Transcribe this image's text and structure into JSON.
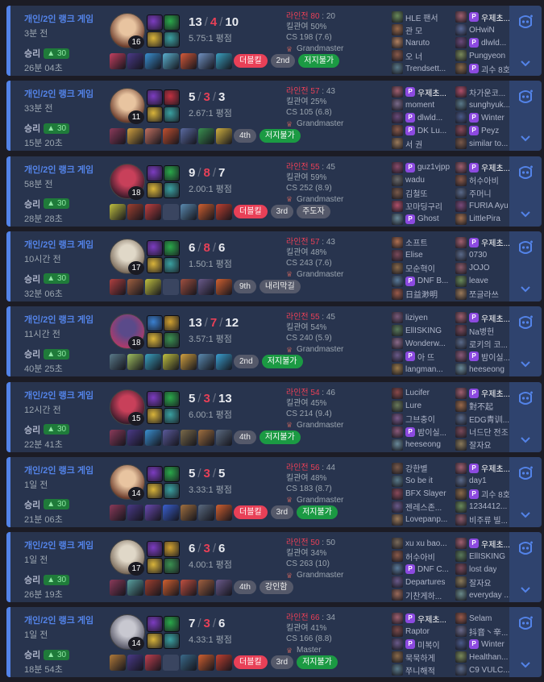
{
  "labels": {
    "kill_participation": "킬관여",
    "avg": "평점",
    "cs": "CS"
  },
  "colors": {
    "win_accent": "#5383e8",
    "lose_text": "#e84057",
    "tag_green": "#1b9a43",
    "tag_red": "#e84057"
  },
  "matches": [
    {
      "queue": "개인/2인 랭크 게임",
      "ago": "3분 전",
      "result": "승리",
      "lp": "30",
      "duration": "26분 04초",
      "champion": "Ahri",
      "level": "16",
      "spells": [
        "#7c3cc0",
        "#2aa84a"
      ],
      "runes": [
        "#d9b43a",
        "#3aa0a0"
      ],
      "kills": "13",
      "deaths": "4",
      "assists": "10",
      "kda_ratio": "5.75:1 평점",
      "items": [
        "#c24060",
        "#4a3a88",
        "#3a8fd0",
        "#5bb0d0",
        "#d45a3a",
        "#7090c0",
        "#3aa0c0"
      ],
      "tags": [
        {
          "text": "더블킬",
          "style": "red"
        },
        {
          "text": "2nd",
          "style": "gray"
        },
        {
          "text": "저지불가",
          "style": "green"
        }
      ],
      "laner": "라인전",
      "laner_score": "80",
      "laner_opp": "20",
      "kp": "킬관여 50%",
      "cs": "CS 198 (7.6)",
      "rank": "Grandmaster",
      "team1": [
        {
          "name": "HLE 팬서",
          "c": "#6a8a5a"
        },
        {
          "name": "관 모",
          "c": "#9a6a4a"
        },
        {
          "name": "Naruto",
          "c": "#b08060"
        },
        {
          "name": "오 너",
          "c": "#8a5a4a"
        },
        {
          "name": "Trendsett...",
          "c": "#5a7a8a"
        }
      ],
      "team2": [
        {
          "name": "우제초...",
          "c": "#a06070",
          "me": true,
          "badge": true
        },
        {
          "name": "OHwiN",
          "c": "#5a6a9a"
        },
        {
          "name": "dlwld...",
          "c": "#6a4a7a",
          "badge": true
        },
        {
          "name": "Pungyeon",
          "c": "#7a8a5a"
        },
        {
          "name": "괴수 8호",
          "c": "#8a6a4a",
          "badge": true
        }
      ]
    },
    {
      "queue": "개인/2인 랭크 게임",
      "ago": "33분 전",
      "result": "승리",
      "lp": "30",
      "duration": "15분 20초",
      "champion": "Ahri",
      "level": "11",
      "spells": [
        "#7c3cc0",
        "#c03040"
      ],
      "runes": [
        "#d9b43a",
        "#3aa0a0"
      ],
      "kills": "5",
      "deaths": "3",
      "assists": "3",
      "kda_ratio": "2.67:1 평점",
      "items": [
        "#8a3a5a",
        "#d0a040",
        "#c07060",
        "#c05030",
        "#5a6aa0",
        "#3a9050",
        "#d0b040"
      ],
      "tags": [
        {
          "text": "4th",
          "style": "gray"
        },
        {
          "text": "저지불가",
          "style": "green"
        }
      ],
      "laner": "라인전",
      "laner_score": "57",
      "laner_opp": "43",
      "kp": "킬관여 25%",
      "cs": "CS 105 (6.8)",
      "rank": "Grandmaster",
      "team1": [
        {
          "name": "우제초...",
          "c": "#a06070",
          "me": true,
          "badge": true
        },
        {
          "name": "moment",
          "c": "#7a6a8a"
        },
        {
          "name": "dlwld...",
          "c": "#6a4a7a",
          "badge": true
        },
        {
          "name": "DK Lu...",
          "c": "#8a5a4a",
          "badge": true
        },
        {
          "name": "서 권",
          "c": "#9a7a5a"
        }
      ],
      "team2": [
        {
          "name": "차가운코...",
          "c": "#b0506a"
        },
        {
          "name": "sunghyuk...",
          "c": "#5a7a8a"
        },
        {
          "name": "Winter",
          "c": "#4a5a8a",
          "badge": true
        },
        {
          "name": "Peyz",
          "c": "#8a4a5a",
          "badge": true
        },
        {
          "name": "similar to...",
          "c": "#7a5a4a"
        }
      ]
    },
    {
      "queue": "개인/2인 랭크 게임",
      "ago": "58분 전",
      "result": "승리",
      "lp": "30",
      "duration": "28분 28초",
      "champion": "Fiora",
      "level": "18",
      "spells": [
        "#7c3cc0",
        "#2aa84a"
      ],
      "runes": [
        "#d9b43a",
        "#3aa0a0"
      ],
      "kills": "9",
      "deaths": "8",
      "assists": "7",
      "kda_ratio": "2.00:1 평점",
      "items": [
        "#c0c040",
        "#a04030",
        "#c04040",
        "empty",
        "#5a8ab0",
        "#d06030",
        "#c04030"
      ],
      "tags": [
        {
          "text": "더블킬",
          "style": "red"
        },
        {
          "text": "3rd",
          "style": "gray"
        },
        {
          "text": "주도자",
          "style": "gray"
        }
      ],
      "laner": "라인전",
      "laner_score": "55",
      "laner_opp": "45",
      "kp": "킬관여 59%",
      "cs": "CS 252 (8.9)",
      "rank": "Grandmaster",
      "team1": [
        {
          "name": "guz1vjpp...",
          "c": "#8a4a6a",
          "badge": true
        },
        {
          "name": "wadu",
          "c": "#6a6a6a"
        },
        {
          "name": "김철또",
          "c": "#7a5a4a"
        },
        {
          "name": "꼬마딩구리",
          "c": "#b0506a"
        },
        {
          "name": "Ghost",
          "c": "#6a8a9a",
          "badge": true
        }
      ],
      "team2": [
        {
          "name": "우제초...",
          "c": "#a06070",
          "me": true,
          "badge": true
        },
        {
          "name": "허수아비",
          "c": "#8a5a4a"
        },
        {
          "name": "주머니",
          "c": "#5a6a8a"
        },
        {
          "name": "FURIA Ayu",
          "c": "#7a4a7a"
        },
        {
          "name": "LittlePira",
          "c": "#a07050"
        }
      ]
    },
    {
      "queue": "개인/2인 랭크 게임",
      "ago": "10시간 전",
      "result": "승리",
      "lp": "30",
      "duration": "32분 06초",
      "champion": "Camille",
      "level": "17",
      "spells": [
        "#7c3cc0",
        "#2aa84a"
      ],
      "runes": [
        "#d9b43a",
        "#3aa0a0"
      ],
      "kills": "6",
      "deaths": "8",
      "assists": "6",
      "kda_ratio": "1.50:1 평점",
      "items": [
        "#b04040",
        "#a06040",
        "#c0c040",
        "empty",
        "#a05040",
        "#6a5a8a",
        "#d06030"
      ],
      "tags": [
        {
          "text": "9th",
          "style": "gray"
        },
        {
          "text": "내리막길",
          "style": "gray"
        }
      ],
      "laner": "라인전",
      "laner_score": "57",
      "laner_opp": "43",
      "kp": "킬관여 48%",
      "cs": "CS 243 (7.6)",
      "rank": "Grandmaster",
      "team1": [
        {
          "name": "소프트",
          "c": "#b07050"
        },
        {
          "name": "Elise",
          "c": "#7a4a5a"
        },
        {
          "name": "모순혁이",
          "c": "#8a6a4a"
        },
        {
          "name": "DNF B...",
          "c": "#5a7a9a",
          "badge": true
        },
        {
          "name": "日益渺明",
          "c": "#9a5a4a"
        }
      ],
      "team2": [
        {
          "name": "우제초...",
          "c": "#a06070",
          "me": true,
          "badge": true
        },
        {
          "name": "0730",
          "c": "#5a6a8a"
        },
        {
          "name": "JOJO",
          "c": "#8a5a6a"
        },
        {
          "name": "leave",
          "c": "#6a8a5a"
        },
        {
          "name": "쪼글라쓰",
          "c": "#9a7a5a"
        }
      ]
    },
    {
      "queue": "개인/2인 랭크 게임",
      "ago": "11시간 전",
      "result": "승리",
      "lp": "30",
      "duration": "40분 25초",
      "champion": "Lucian",
      "level": "18",
      "spells": [
        "#3a80d0",
        "#d0a030"
      ],
      "runes": [
        "#d9b43a",
        "#3a9050"
      ],
      "kills": "13",
      "deaths": "7",
      "assists": "12",
      "kda_ratio": "3.57:1 평점",
      "items": [
        "#5a7a8a",
        "#a0c060",
        "#3aa0c0",
        "#c0c040",
        "#d0a040",
        "#5a8ab0",
        "#3a9fd0"
      ],
      "tags": [
        {
          "text": "2nd",
          "style": "gray"
        },
        {
          "text": "저지불가",
          "style": "green"
        }
      ],
      "laner": "라인전",
      "laner_score": "55",
      "laner_opp": "45",
      "kp": "킬관여 54%",
      "cs": "CS 240 (5.9)",
      "rank": "Grandmaster",
      "team1": [
        {
          "name": "liziyen",
          "c": "#7a5a7a"
        },
        {
          "name": "EllISKING",
          "c": "#5a7a5a"
        },
        {
          "name": "Wonderw...",
          "c": "#8a6a8a"
        },
        {
          "name": "아 뜨",
          "c": "#6a5a8a",
          "badge": true
        },
        {
          "name": "langman...",
          "c": "#9a7a4a"
        }
      ],
      "team2": [
        {
          "name": "우제초...",
          "c": "#a06070",
          "me": true,
          "badge": true
        },
        {
          "name": "Na병헌",
          "c": "#7a4a5a"
        },
        {
          "name": "로키의 코...",
          "c": "#5a6a8a"
        },
        {
          "name": "밤이실...",
          "c": "#8a5a7a",
          "badge": true
        },
        {
          "name": "heeseong",
          "c": "#6a8a9a"
        }
      ]
    },
    {
      "queue": "개인/2인 랭크 게임",
      "ago": "12시간 전",
      "result": "승리",
      "lp": "30",
      "duration": "22분 41초",
      "champion": "Fiora",
      "level": "15",
      "spells": [
        "#7c3cc0",
        "#2aa84a"
      ],
      "runes": [
        "#d9b43a",
        "#3aa0a0"
      ],
      "kills": "5",
      "deaths": "3",
      "assists": "13",
      "kda_ratio": "6.00:1 평점",
      "items": [
        "#8a3a5a",
        "#4a3a88",
        "#3a8fd0",
        "#5a5a9a",
        "#7a6a4a",
        "#a07040",
        "#5a6a80"
      ],
      "tags": [
        {
          "text": "4th",
          "style": "gray"
        },
        {
          "text": "저지불가",
          "style": "green"
        }
      ],
      "laner": "라인전",
      "laner_score": "54",
      "laner_opp": "46",
      "kp": "킬관여 45%",
      "cs": "CS 214 (9.4)",
      "rank": "Grandmaster",
      "team1": [
        {
          "name": "Lucifer",
          "c": "#8a4a4a"
        },
        {
          "name": "Lure",
          "c": "#6a7a5a"
        },
        {
          "name": "그브충이",
          "c": "#7a5a8a"
        },
        {
          "name": "밤이실...",
          "c": "#8a5a7a",
          "badge": true
        },
        {
          "name": "heeseong",
          "c": "#6a8a9a"
        }
      ],
      "team2": [
        {
          "name": "우제초...",
          "c": "#a06070",
          "me": true,
          "badge": true
        },
        {
          "name": "對不起",
          "c": "#9a6a4a"
        },
        {
          "name": "EDG青训...",
          "c": "#5a6a8a"
        },
        {
          "name": "너드단 전조",
          "c": "#7a4a5a"
        },
        {
          "name": "잘자요",
          "c": "#8a7a5a"
        }
      ]
    },
    {
      "queue": "개인/2인 랭크 게임",
      "ago": "1일 전",
      "result": "승리",
      "lp": "30",
      "duration": "21분 06초",
      "champion": "Ahri",
      "level": "14",
      "spells": [
        "#7c3cc0",
        "#2aa84a"
      ],
      "runes": [
        "#d9b43a",
        "#3aa0a0"
      ],
      "kills": "5",
      "deaths": "3",
      "assists": "5",
      "kda_ratio": "3.33:1 평점",
      "items": [
        "#8a3a5a",
        "#4a3a88",
        "#6a4ab0",
        "#3a60d0",
        "#a07040",
        "#5a6a80",
        "#d06030"
      ],
      "tags": [
        {
          "text": "더블킬",
          "style": "red"
        },
        {
          "text": "3rd",
          "style": "gray"
        },
        {
          "text": "저지불가",
          "style": "green"
        }
      ],
      "laner": "라인전",
      "laner_score": "56",
      "laner_opp": "44",
      "kp": "킬관여 48%",
      "cs": "CS 183 (8.7)",
      "rank": "Grandmaster",
      "team1": [
        {
          "name": "강한별",
          "c": "#7a5a4a"
        },
        {
          "name": "So be it",
          "c": "#5a7a8a"
        },
        {
          "name": "BFX Slayer",
          "c": "#8a4a5a"
        },
        {
          "name": "젠레스존...",
          "c": "#6a5a8a"
        },
        {
          "name": "Lovepanp...",
          "c": "#9a7a5a"
        }
      ],
      "team2": [
        {
          "name": "우제초...",
          "c": "#a06070",
          "me": true,
          "badge": true
        },
        {
          "name": "day1",
          "c": "#5a6a8a"
        },
        {
          "name": "괴수 8호",
          "c": "#8a6a4a",
          "badge": true
        },
        {
          "name": "1234412...",
          "c": "#6a8a5a"
        },
        {
          "name": "비주류 빌...",
          "c": "#8a5a6a"
        }
      ]
    },
    {
      "queue": "개인/2인 랭크 게임",
      "ago": "1일 전",
      "result": "승리",
      "lp": "30",
      "duration": "26분 19초",
      "champion": "Camille",
      "level": "17",
      "spells": [
        "#7c3cc0",
        "#d0a030"
      ],
      "runes": [
        "#d9b43a",
        "#3a9050"
      ],
      "kills": "6",
      "deaths": "3",
      "assists": "6",
      "kda_ratio": "4.00:1 평점",
      "items": [
        "#8a3a5a",
        "#5aa0a0",
        "#a04030",
        "#d06030",
        "#c05040",
        "#a06040",
        "#6a5a8a"
      ],
      "tags": [
        {
          "text": "4th",
          "style": "gray"
        },
        {
          "text": "강인함",
          "style": "gray"
        }
      ],
      "laner": "라인전",
      "laner_score": "50",
      "laner_opp": "50",
      "kp": "킬관여 34%",
      "cs": "CS 263 (10)",
      "rank": "Grandmaster",
      "team1": [
        {
          "name": "xu xu bao...",
          "c": "#7a6a5a"
        },
        {
          "name": "허수아비",
          "c": "#8a5a4a"
        },
        {
          "name": "DNF C...",
          "c": "#5a7a9a",
          "badge": true
        },
        {
          "name": "Departures",
          "c": "#6a5a8a"
        },
        {
          "name": "기찬게하...",
          "c": "#9a6a5a"
        }
      ],
      "team2": [
        {
          "name": "우제초...",
          "c": "#a06070",
          "me": true,
          "badge": true
        },
        {
          "name": "EllISKING",
          "c": "#5a7a5a"
        },
        {
          "name": "lost day",
          "c": "#7a4a5a"
        },
        {
          "name": "잘자요",
          "c": "#8a7a5a"
        },
        {
          "name": "everyday ...",
          "c": "#6a8a8a"
        }
      ]
    },
    {
      "queue": "개인/2인 랭크 게임",
      "ago": "1일 전",
      "result": "승리",
      "lp": "30",
      "duration": "18분 54초",
      "champion": "Jax",
      "level": "14",
      "spells": [
        "#7c3cc0",
        "#2aa84a"
      ],
      "runes": [
        "#d9b43a",
        "#3aa0a0"
      ],
      "kills": "7",
      "deaths": "3",
      "assists": "6",
      "kda_ratio": "4.33:1 평점",
      "items": [
        "#b07a3a",
        "#4a3a88",
        "#c04050",
        "empty",
        "#3a6a8a",
        "#d06030",
        "#c04030"
      ],
      "tags": [
        {
          "text": "더블킬",
          "style": "red"
        },
        {
          "text": "3rd",
          "style": "gray"
        },
        {
          "text": "저지불가",
          "style": "green"
        }
      ],
      "laner": "라인전",
      "laner_score": "66",
      "laner_opp": "34",
      "kp": "킬관여 41%",
      "cs": "CS 166 (8.8)",
      "rank": "Master",
      "team1": [
        {
          "name": "우제초...",
          "c": "#a06070",
          "me": true,
          "badge": true
        },
        {
          "name": "Raptor",
          "c": "#7a4a4a"
        },
        {
          "name": "미복이",
          "c": "#6a5a8a",
          "badge": true
        },
        {
          "name": "묵묵하게",
          "c": "#8a6a4a"
        },
        {
          "name": "쭈니해적",
          "c": "#5a7a8a"
        }
      ],
      "team2": [
        {
          "name": "Selam",
          "c": "#9a5a4a"
        },
        {
          "name": "抖音丶辛...",
          "c": "#6a6a8a"
        },
        {
          "name": "Winter",
          "c": "#4a5a8a",
          "badge": true
        },
        {
          "name": "Healthan...",
          "c": "#7a8a5a"
        },
        {
          "name": "C9 VULC...",
          "c": "#5a6a8a"
        }
      ]
    }
  ]
}
